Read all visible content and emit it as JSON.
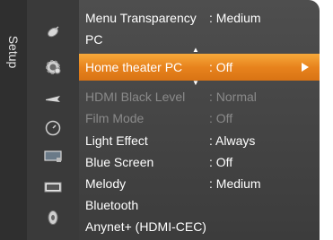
{
  "sidebar": {
    "label": "Setup"
  },
  "menu": {
    "items": [
      {
        "label": "Menu Transparency",
        "value": ": Medium"
      },
      {
        "label": "PC",
        "value": ""
      },
      {
        "label": "Home theater PC",
        "value": ": Off"
      },
      {
        "label": "HDMI Black Level",
        "value": ": Normal"
      },
      {
        "label": "Film Mode",
        "value": ": Off"
      },
      {
        "label": "Light Effect",
        "value": ": Always"
      },
      {
        "label": "Blue Screen",
        "value": ": Off"
      },
      {
        "label": "Melody",
        "value": ": Medium"
      },
      {
        "label": "Bluetooth",
        "value": ""
      },
      {
        "label": "Anynet+ (HDMI-CEC)",
        "value": ""
      }
    ],
    "scroll_up": "▲",
    "scroll_down": "▼",
    "selected_arrow": "▶"
  },
  "colors": {
    "highlight": "#e8831d",
    "dim_text": "#8a8a8a"
  },
  "icons": [
    "satellite-icon",
    "gear-icon",
    "plane-icon",
    "clock-icon",
    "tv-icon",
    "screen-icon",
    "disc-icon"
  ]
}
